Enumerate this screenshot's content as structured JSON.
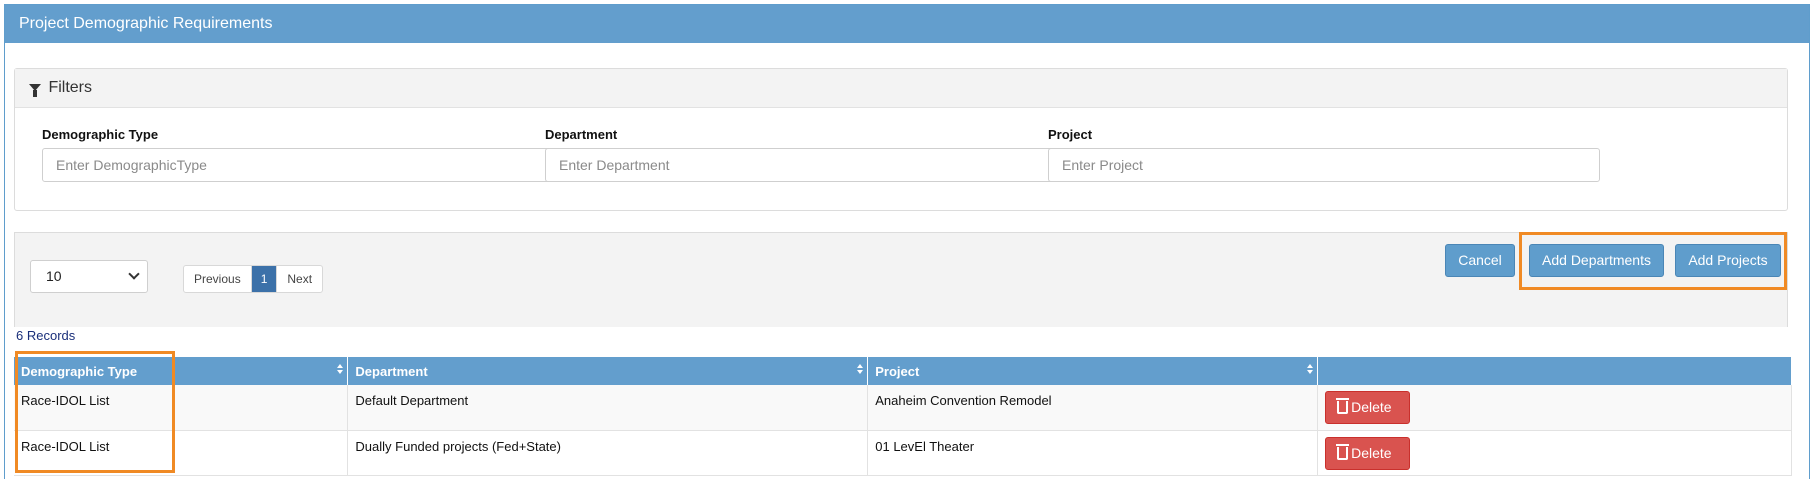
{
  "header": {
    "title": "Project Demographic Requirements"
  },
  "filters": {
    "heading": "Filters",
    "icon": "filter-icon",
    "demographic_type": {
      "label": "Demographic Type",
      "placeholder": "Enter DemographicType"
    },
    "department": {
      "label": "Department",
      "placeholder": "Enter Department"
    },
    "project": {
      "label": "Project",
      "placeholder": "Enter Project"
    }
  },
  "toolbar": {
    "page_size": "10",
    "pager": {
      "previous": "Previous",
      "current": "1",
      "next": "Next"
    },
    "cancel": "Cancel",
    "add_departments": "Add Departments",
    "add_projects": "Add Projects"
  },
  "records_count": "6 Records",
  "table": {
    "columns": [
      "Demographic Type",
      "Department",
      "Project",
      ""
    ],
    "rows": [
      {
        "demographic_type": "Race-IDOL List",
        "department": "Default Department",
        "project": "Anaheim Convention Remodel",
        "action": "Delete"
      },
      {
        "demographic_type": "Race-IDOL List",
        "department": "Dually Funded projects (Fed+State)",
        "project": "01 LevEl Theater",
        "action": "Delete"
      }
    ]
  },
  "colors": {
    "header": "#639ecd",
    "primary": "#5f9dcc",
    "danger": "#d9534f",
    "highlight": "#f08a24"
  }
}
